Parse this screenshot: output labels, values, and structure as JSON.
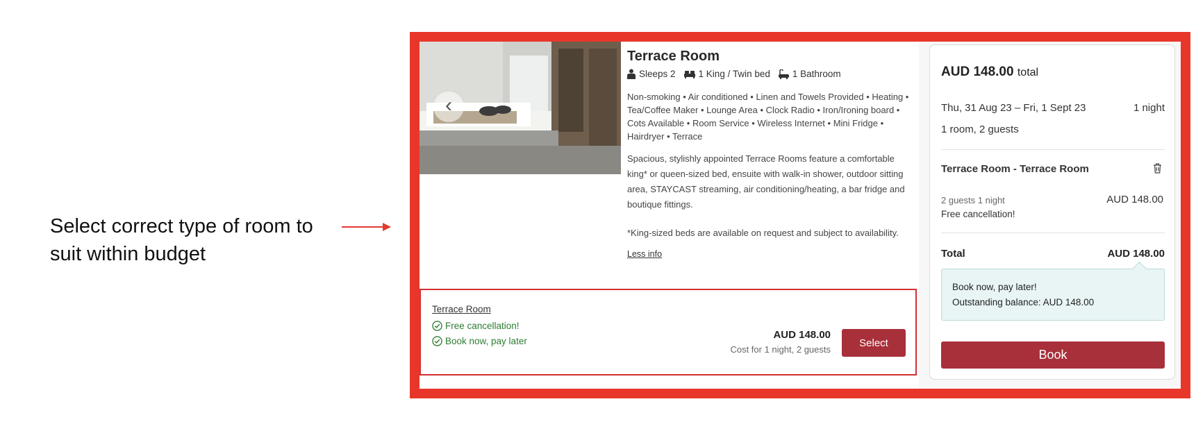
{
  "annotation": {
    "text": "Select correct type of room to suit within budget"
  },
  "room": {
    "title": "Terrace Room",
    "sleeps": "Sleeps 2",
    "beds": "1 King / Twin bed",
    "bathrooms": "1 Bathroom",
    "amenities": [
      "Non-smoking",
      "Air conditioned",
      "Linen and Towels Provided",
      "Heating",
      "Tea/Coffee Maker",
      "Lounge Area",
      "Clock Radio",
      "Iron/Ironing board",
      "Cots Available",
      "Room Service",
      "Wireless Internet",
      "Mini Fridge",
      "Hairdryer",
      "Terrace"
    ],
    "description": "Spacious, stylishly appointed Terrace Rooms feature a comfortable king* or queen-sized bed, ensuite with walk-in shower, outdoor sitting area, STAYCAST streaming, air conditioning/heating, a bar fridge and boutique fittings.",
    "note": "*King-sized beds are available on request and subject to availability.",
    "less_info": "Less info",
    "carousel_prev": "‹"
  },
  "rate": {
    "name": "Terrace Room",
    "perks": [
      "Free cancellation!",
      "Book now, pay later"
    ],
    "price": "AUD 148.00",
    "price_sub": "Cost for 1 night, 2 guests",
    "select_label": "Select"
  },
  "summary": {
    "total_amount": "AUD 148.00",
    "total_suffix": "total",
    "dates": "Thu, 31 Aug 23 – Fri, 1 Sept 23",
    "nights": "1 night",
    "rooms_guests": "1 room, 2 guests",
    "room_line": "Terrace Room - Terrace Room",
    "detail": "2 guests 1 night",
    "detail_price": "AUD 148.00",
    "cancellation": "Free cancellation!",
    "total_label": "Total",
    "total_value": "AUD 148.00",
    "pay_later_title": "Book now, pay later!",
    "outstanding": "Outstanding balance: AUD 148.00",
    "book_label": "Book"
  },
  "colors": {
    "frame": "#e8372a",
    "accent": "#a8303a",
    "perk_green": "#2e7d32",
    "pay_later_bg": "#e9f5f5"
  },
  "icons": [
    "person-icon",
    "bed-icon",
    "bathtub-icon",
    "check-circle-icon",
    "trash-icon",
    "chevron-left-icon"
  ]
}
